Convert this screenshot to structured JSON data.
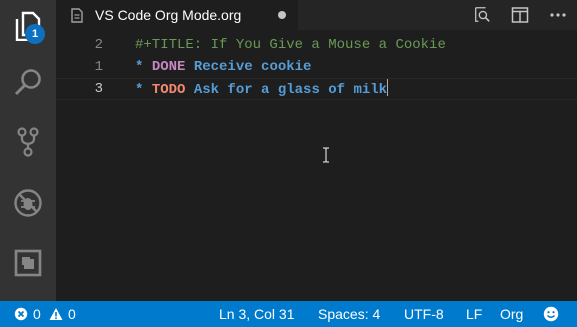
{
  "activity_bar": {
    "items": [
      {
        "name": "explorer",
        "icon": "files-icon",
        "badge": "1"
      },
      {
        "name": "search",
        "icon": "search-icon"
      },
      {
        "name": "source-control",
        "icon": "source-control-icon"
      },
      {
        "name": "debug",
        "icon": "debug-icon"
      },
      {
        "name": "extensions",
        "icon": "extensions-icon"
      }
    ]
  },
  "tab": {
    "title": "VS Code Org Mode.org",
    "icon": "file-icon",
    "dirty": true,
    "actions": [
      "open-preview-icon",
      "split-editor-icon"
    ]
  },
  "editor": {
    "lines": [
      {
        "number": "2",
        "text": "#+TITLE: If You Give a Mouse a Cookie"
      },
      {
        "number": "1",
        "star": "*",
        "keyword": "DONE",
        "heading": "Receive cookie"
      },
      {
        "number": "3",
        "star": "*",
        "keyword": "TODO",
        "heading": "Ask for a glass of milk"
      }
    ]
  },
  "status_bar": {
    "errors": "0",
    "warnings": "0",
    "position": "Ln 3, Col 31",
    "spaces": "Spaces: 4",
    "encoding": "UTF-8",
    "eol": "LF",
    "language": "Org",
    "feedback_icon": "smiley-icon"
  },
  "colors": {
    "accent": "#007acc",
    "badge": "#0e70c0",
    "done": "#c586c0",
    "todo": "#f48771",
    "heading": "#569cd6",
    "comment": "#6a9955"
  }
}
